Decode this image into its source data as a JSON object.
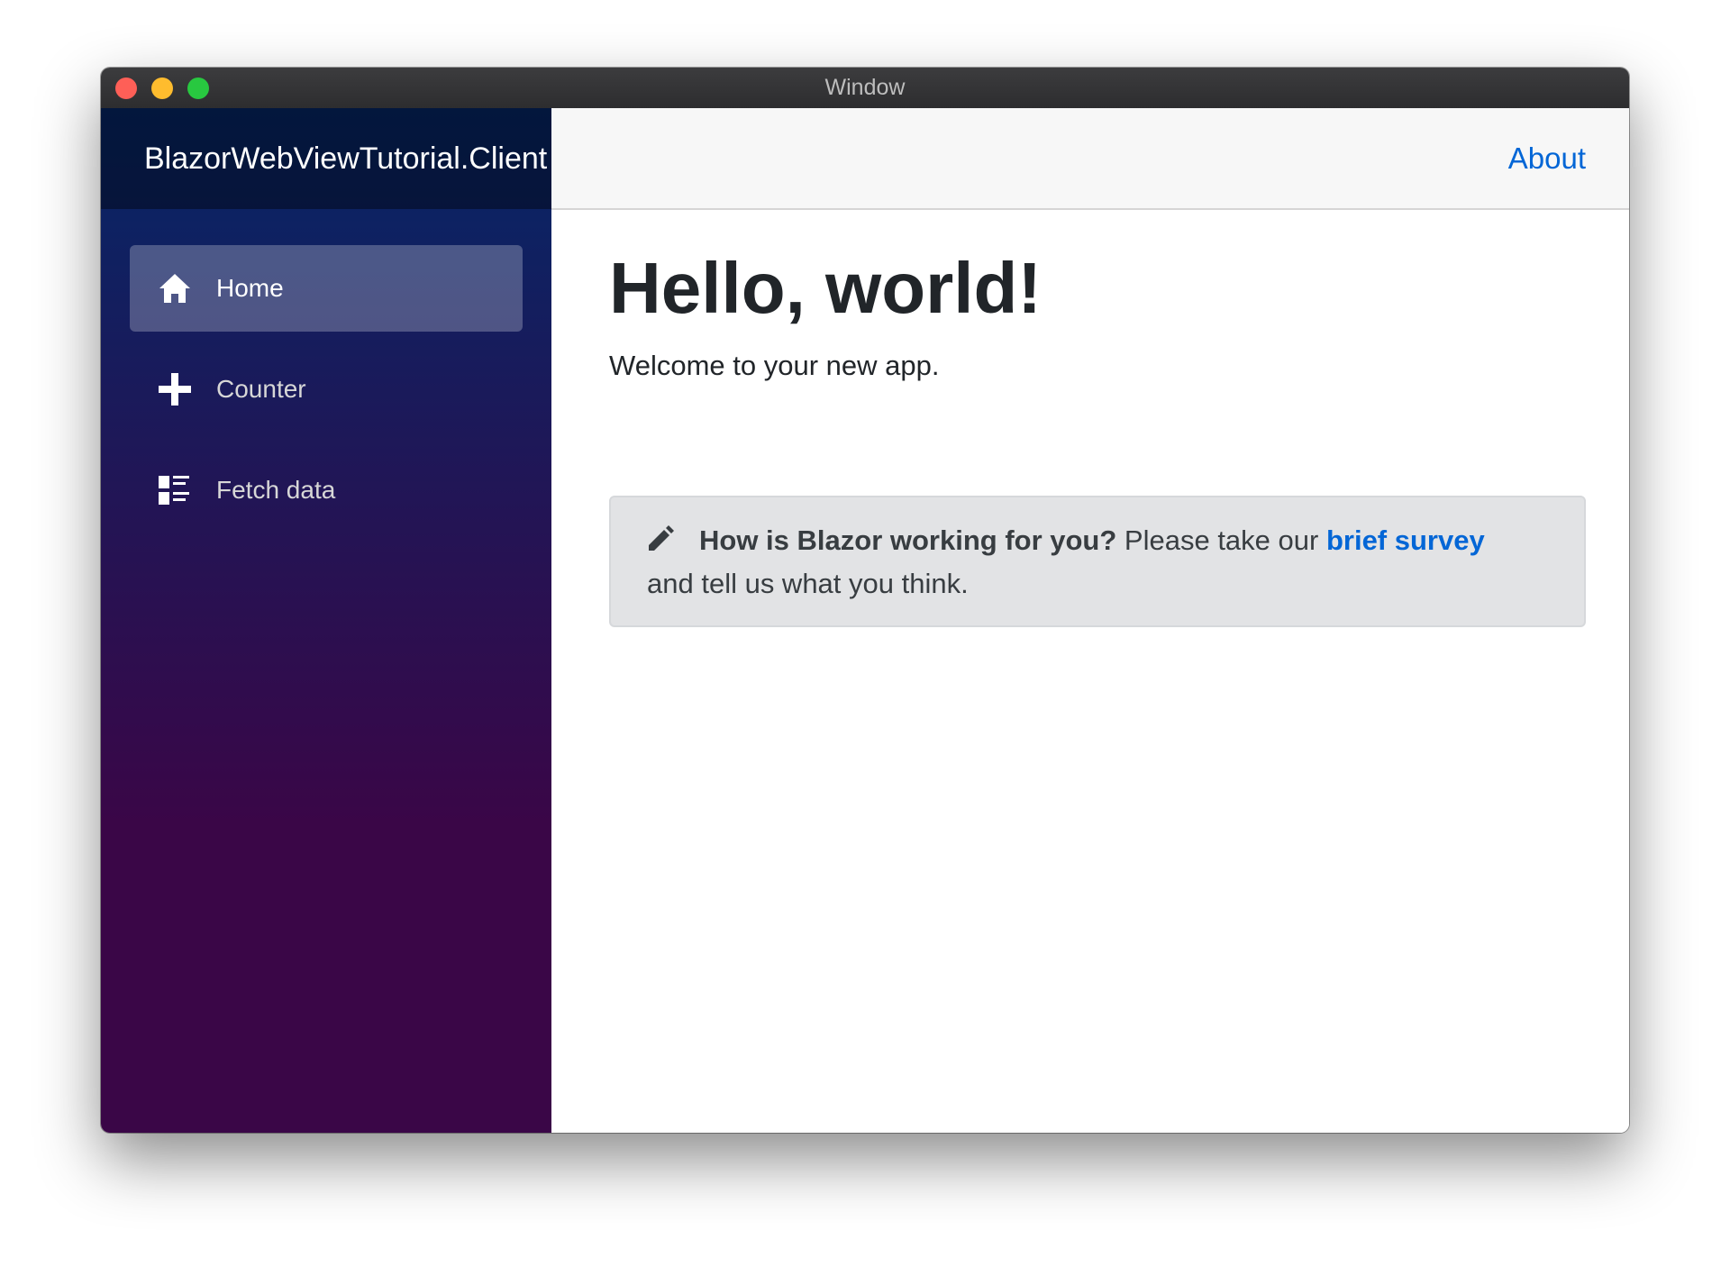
{
  "window": {
    "title": "Window"
  },
  "sidebar": {
    "brand": "BlazorWebViewTutorial.Client",
    "items": [
      {
        "label": "Home",
        "icon": "home-icon",
        "active": true
      },
      {
        "label": "Counter",
        "icon": "plus-icon",
        "active": false
      },
      {
        "label": "Fetch data",
        "icon": "list-icon",
        "active": false
      }
    ]
  },
  "topbar": {
    "about_label": "About"
  },
  "main": {
    "title": "Hello, world!",
    "lead": "Welcome to your new app.",
    "survey": {
      "question": "How is Blazor working for you?",
      "prompt": " Please take our ",
      "link_label": "brief survey",
      "tail": "and tell us what you think."
    }
  },
  "colors": {
    "link": "#0366d6",
    "sidebar_top": "#052767",
    "sidebar_bottom": "#3a0647",
    "alert_bg": "#e2e3e5"
  }
}
